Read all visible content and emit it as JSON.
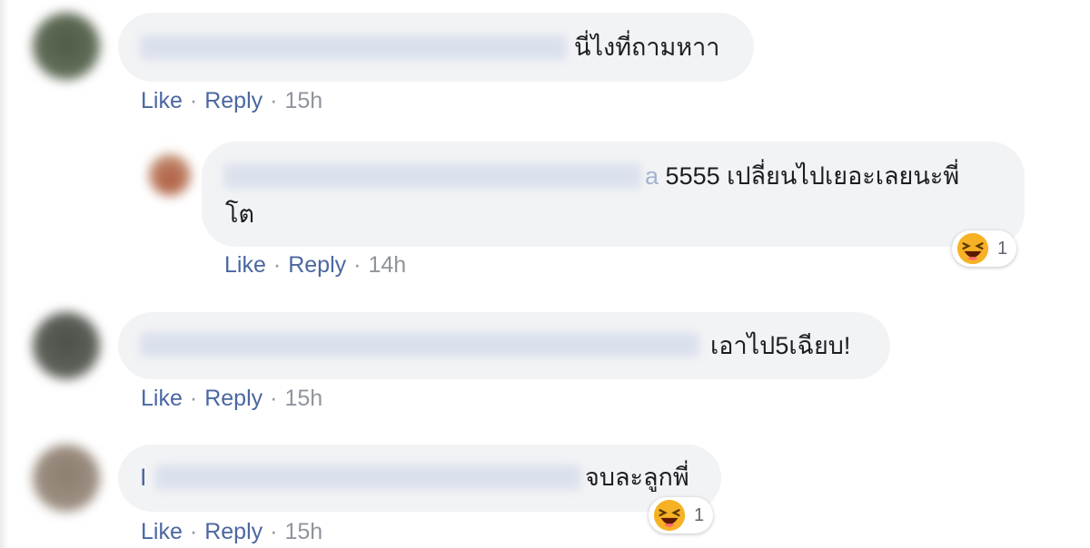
{
  "comments": [
    {
      "text": "นี่ไงที่ถามหาา",
      "actions": {
        "like": "Like",
        "reply": "Reply",
        "time": "15h",
        "sep": "·"
      }
    },
    {
      "name_suffix": "a",
      "text_line1": "5555 เปลี่ยนไปเยอะเลยนะพี่",
      "text_line2": "โต",
      "reaction": {
        "icon": "haha-emoji-icon",
        "count": "1"
      },
      "actions": {
        "like": "Like",
        "reply": "Reply",
        "time": "14h",
        "sep": "·"
      }
    },
    {
      "text": "เอาไป5เฉียบ!",
      "actions": {
        "like": "Like",
        "reply": "Reply",
        "time": "15h",
        "sep": "·"
      }
    },
    {
      "name_prefix": "I",
      "text": "จบละลูกพี่",
      "reaction": {
        "icon": "haha-emoji-icon",
        "count": "1"
      },
      "actions": {
        "like": "Like",
        "reply": "Reply",
        "time": "15h",
        "sep": "·"
      }
    }
  ],
  "colors": {
    "bubble": "#f2f3f5",
    "link": "#4b67a1",
    "meta": "#90949c",
    "text": "#1c1e21"
  }
}
